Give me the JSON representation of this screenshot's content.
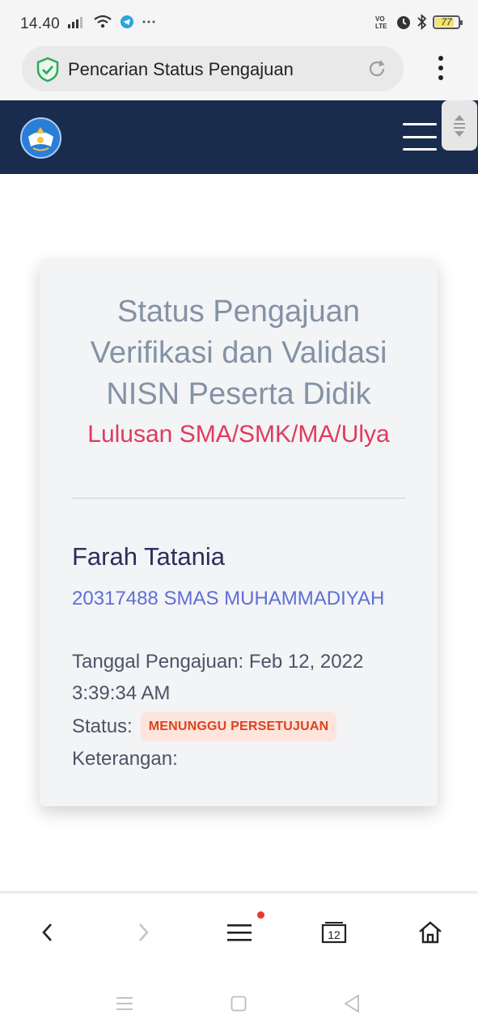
{
  "status_bar": {
    "time": "14.40",
    "network_label": "LTE",
    "battery_level": "77"
  },
  "browser": {
    "url_title": "Pencarian Status Pengajuan"
  },
  "card": {
    "title": "Status Pengajuan Verifikasi dan Validasi NISN Peserta Didik",
    "subtitle": "Lulusan SMA/SMK/MA/Ulya",
    "student_name": "Farah Tatania",
    "school": "20317488 SMAS MUHAMMADIYAH",
    "date": "Tanggal Pengajuan: Feb 12, 2022 3:39:34 AM",
    "status_label": "Status:",
    "status_value": "MENUNGGU PERSETUJUAN",
    "keterangan_label": "Keterangan:"
  },
  "bottom_nav": {
    "tabs_count": "12"
  },
  "colors": {
    "header_bg": "#1a2c4e",
    "title": "#8492a6",
    "subtitle": "#e03a5e",
    "school": "#5f6fd6",
    "status_badge_bg": "#fde4dc",
    "status_badge_text": "#e0421c"
  }
}
